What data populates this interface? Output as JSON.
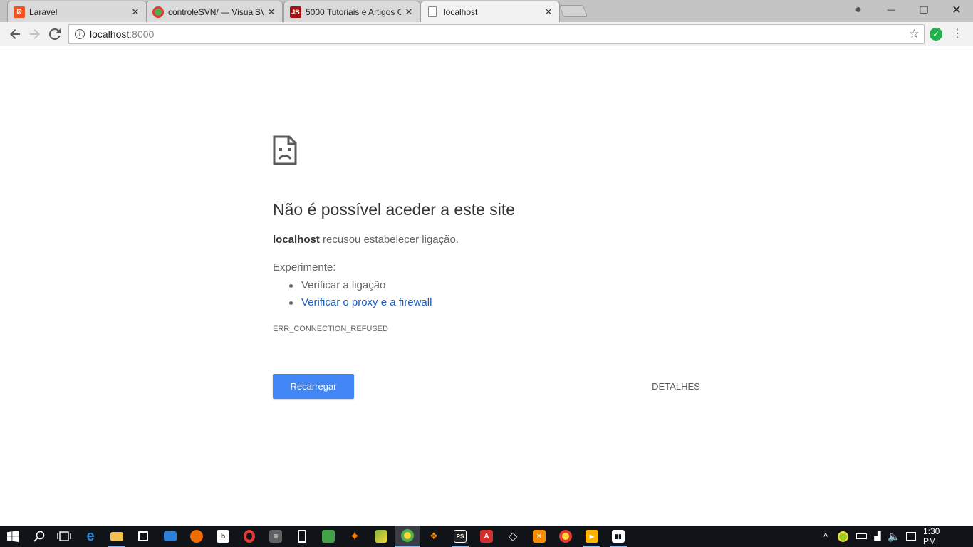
{
  "browser": {
    "tabs": [
      {
        "title": "Laravel",
        "favicon": "laravel-icon",
        "color": "#f4511e"
      },
      {
        "title": "controleSVN/ — VisualSV",
        "favicon": "chrome-icon",
        "color": "#4caf50"
      },
      {
        "title": "5000 Tutoriais e Artigos C",
        "favicon": "jb-icon",
        "favicon_text": "JB",
        "color": "#a31010"
      },
      {
        "title": "localhost",
        "favicon": "page-icon",
        "color": "#888888"
      }
    ],
    "active_tab": 3,
    "close_glyph": "✕",
    "window_controls": {
      "profile": "●",
      "minimize": "—",
      "restore": "❐",
      "close": "✕"
    }
  },
  "toolbar": {
    "url_host": "localhost",
    "url_port": ":8000",
    "info_glyph": "i",
    "star_glyph": "☆",
    "extension_glyph": "✓",
    "extension_color": "#21b04b",
    "menu_glyph": "⋮"
  },
  "error_page": {
    "heading": "Não é possível aceder a este site",
    "host": "localhost",
    "summary_rest": " recusou estabelecer ligação.",
    "suggestions_title": "Experimente:",
    "suggestions": [
      {
        "text": "Verificar a ligação",
        "is_link": false
      },
      {
        "text": "Verificar o proxy e a firewall",
        "is_link": true
      }
    ],
    "error_code": "ERR_CONNECTION_REFUSED",
    "reload_label": "Recarregar",
    "details_label": "DETALHES",
    "button_color": "#4285f4",
    "link_color": "#1a5bc6"
  },
  "taskbar": {
    "apps": [
      {
        "name": "start-button",
        "glyph": "⊞",
        "color": "#101318"
      },
      {
        "name": "search-icon",
        "glyph": "⌕",
        "color": "#101318"
      },
      {
        "name": "task-view-icon",
        "glyph": "▭",
        "color": "#101318"
      },
      {
        "name": "edge-icon",
        "glyph": "e",
        "color": "#1e88e5"
      },
      {
        "name": "file-explorer-icon",
        "glyph": "▬",
        "color": "#f2c14e"
      },
      {
        "name": "store-icon",
        "glyph": "▣",
        "color": "#101318"
      },
      {
        "name": "remote-desktop-icon",
        "glyph": "▢",
        "color": "#2f7fd6"
      },
      {
        "name": "firefox-icon",
        "glyph": "◉",
        "color": "#ef6c00"
      },
      {
        "name": "bracket-icon",
        "glyph": "b",
        "color": "#ffffff"
      },
      {
        "name": "opera-icon",
        "glyph": "O",
        "color": "#e53935"
      },
      {
        "name": "sublime-icon",
        "glyph": "≡",
        "color": "#616161"
      },
      {
        "name": "calculator-icon",
        "glyph": "▦",
        "color": "#101318"
      },
      {
        "name": "sheets-icon",
        "glyph": "▤",
        "color": "#43a047"
      },
      {
        "name": "avast-icon",
        "glyph": "✦",
        "color": "#f57c00"
      },
      {
        "name": "paint-icon",
        "glyph": "◆",
        "color": "#7cb342"
      },
      {
        "name": "chrome-icon",
        "glyph": "◎",
        "color": "#4caf50"
      },
      {
        "name": "mysql-icon",
        "glyph": "🐬",
        "color": "#101318"
      },
      {
        "name": "phpstorm-icon",
        "glyph": "PS",
        "color": "#222222"
      },
      {
        "name": "acrobat-icon",
        "glyph": "A",
        "color": "#d32f2f"
      },
      {
        "name": "git-icon",
        "glyph": "◇",
        "color": "#101318"
      },
      {
        "name": "xampp-icon",
        "glyph": "✕",
        "color": "#fb8c00"
      },
      {
        "name": "chrome-alt-icon",
        "glyph": "◎",
        "color": "#e53935"
      },
      {
        "name": "media-player-icon",
        "glyph": "▶",
        "color": "#ffb300"
      },
      {
        "name": "movie-maker-icon",
        "glyph": "🎬",
        "color": "#101318"
      }
    ],
    "active_app": 15,
    "tray": {
      "chevron": "^",
      "clock": "1:30 PM"
    }
  }
}
